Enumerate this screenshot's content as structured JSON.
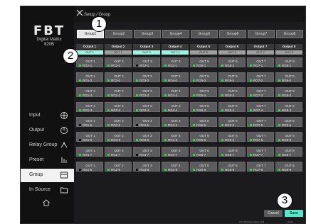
{
  "app": {
    "logo": "FBT",
    "product_line1": "Digital Matrix",
    "product_line2": "820B",
    "header_title": "Setup / Group"
  },
  "sidebar": {
    "items": [
      {
        "label": "Input",
        "icon": "input-icon"
      },
      {
        "label": "Output",
        "icon": "output-icon"
      },
      {
        "label": "Relay Group",
        "icon": "relay-icon"
      },
      {
        "label": "Preset",
        "icon": "preset-icon"
      },
      {
        "label": "Group",
        "icon": "group-icon",
        "active": true
      },
      {
        "label": "In Source",
        "icon": "source-icon"
      }
    ]
  },
  "tabs": [
    "Group1",
    "Group2",
    "Group3",
    "Group4",
    "Group5",
    "Group6",
    "Group7",
    "Group8"
  ],
  "grid": {
    "columns": [
      {
        "title": "Output 1",
        "state": "OUT 1",
        "selected": true
      },
      {
        "title": "Output 2",
        "state": "OUT 2",
        "selected": false
      },
      {
        "title": "Output 3",
        "state": "OUT 3",
        "selected": true
      },
      {
        "title": "Output 4",
        "state": "OUT 4",
        "selected": true
      },
      {
        "title": "Output 5",
        "state": "OUT 5",
        "selected": false
      },
      {
        "title": "Output 6",
        "state": "OUT 6",
        "selected": false
      },
      {
        "title": "Output 7",
        "state": "OUT 7",
        "selected": false
      },
      {
        "title": "Output 8",
        "state": "OUT 8",
        "selected": false
      }
    ],
    "rows": [
      {
        "relays": [
          "RG1-1",
          "RG2-1",
          "RG3-1",
          "RG4-1",
          "RG5-1",
          "RG6-1",
          "RG7-1",
          "RG8-1"
        ],
        "green": [
          true,
          true,
          false,
          true,
          true,
          true,
          true,
          true
        ]
      },
      {
        "relays": [
          "RG1-2",
          "RG2-2",
          "RG3-2",
          "RG4-2",
          "RG5-2",
          "RG6-2",
          "RG7-2",
          "RG8-2"
        ],
        "green": [
          true,
          true,
          true,
          true,
          true,
          true,
          true,
          true
        ]
      },
      {
        "relays": [
          "RG1-3",
          "RG2-3",
          "RG3-3",
          "RG4-3",
          "RG5-3",
          "RG6-3",
          "RG7-3",
          "RG8-3"
        ],
        "green": [
          true,
          true,
          true,
          true,
          true,
          true,
          true,
          true
        ]
      },
      {
        "relays": [
          "RG1-4",
          "RG2-4",
          "RG3-4",
          "RG4-4",
          "RG5-4",
          "RG6-4",
          "RG7-4",
          "RG8-4"
        ],
        "green": [
          true,
          true,
          true,
          true,
          true,
          true,
          true,
          true
        ]
      },
      {
        "relays": [
          "RG1-5",
          "RG2-5",
          "RG3-5",
          "RG4-5",
          "RG5-5",
          "RG6-5",
          "RG7-5",
          "RG8-5"
        ],
        "green": [
          false,
          true,
          false,
          true,
          true,
          true,
          true,
          true
        ]
      },
      {
        "relays": [
          "RG1-6",
          "RG2-6",
          "RG3-6",
          "RG4-6",
          "RG5-6",
          "RG6-6",
          "RG7-6",
          "RG8-6"
        ],
        "green": [
          false,
          true,
          true,
          true,
          true,
          true,
          true,
          true
        ]
      },
      {
        "relays": [
          "RG1-7",
          "RG2-7",
          "RG3-7",
          "RG4-7",
          "RG5-7",
          "RG6-7",
          "RG7-7",
          "RG8-7"
        ],
        "green": [
          true,
          true,
          false,
          true,
          true,
          true,
          true,
          true
        ]
      },
      {
        "relays": [
          "RG1-8",
          "RG2-8",
          "RG3-8",
          "RG4-8",
          "RG5-8",
          "RG6-8",
          "RG7-8",
          "RG8-8"
        ],
        "green": [
          false,
          true,
          false,
          true,
          true,
          true,
          true,
          true
        ]
      }
    ]
  },
  "footer": {
    "cancel": "Cancel",
    "save": "Save",
    "version": "2.0 FW Version Date 2.1.8",
    "mode": "Mode"
  },
  "callouts": [
    "1",
    "2",
    "3"
  ],
  "colors": {
    "accent": "#59e6c8",
    "selected": "#9ff2df",
    "active_dot": "#2cd44c"
  }
}
